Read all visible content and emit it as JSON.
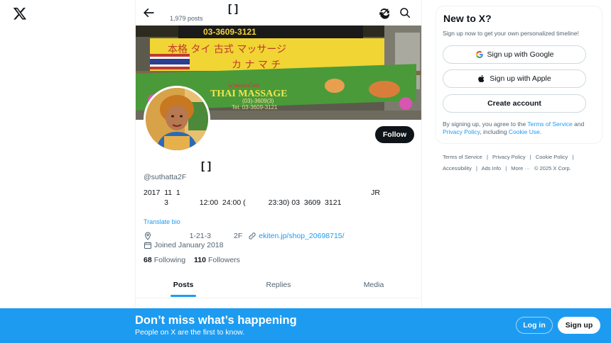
{
  "nav": {
    "logo_icon": "x-logo-icon"
  },
  "header": {
    "title": "[            ]",
    "posts_count": "1,979 posts",
    "back_icon": "arrow-left-icon",
    "icons": [
      "refresh-icon",
      "search-icon"
    ]
  },
  "banner": {
    "phone_top": "03-3609-3121",
    "sign_jp_1": "本格 タイ 古式 マッサージ",
    "sign_jp_2": "カ ナ マ チ",
    "banner_thai": "นวดแผนไทย",
    "banner_en": "THAI MASSAGE",
    "banner_phone": "Tel. 03-3609-3121",
    "banner_sub": "(03)-3609(3)"
  },
  "profile": {
    "name": "[            ]",
    "handle": "@suthatta2F",
    "follow_label": "Follow",
    "bio_line_1": "2017  11  1                                                                                            JR",
    "bio_line_2": "          3               12:00  24:00 (           23:30) 03  3609  3121",
    "translate_label": "Translate bio",
    "location": "                 1-21-3           2F",
    "website": "ekiten.jp/shop_20698715/",
    "joined": "Joined January 2018",
    "following_count": "68",
    "following_label": "Following",
    "followers_count": "110",
    "followers_label": "Followers"
  },
  "tabs": [
    {
      "label": "Posts",
      "active": true
    },
    {
      "label": "Replies",
      "active": false
    },
    {
      "label": "Media",
      "active": false
    }
  ],
  "signup_card": {
    "title": "New to X?",
    "subtitle": "Sign up now to get your own personalized timeline!",
    "google_label": "Sign up with Google",
    "apple_label": "Sign up with Apple",
    "create_label": "Create account",
    "terms_prefix": "By signing up, you agree to the ",
    "terms_link": "Terms of Service",
    "terms_and": " and ",
    "privacy_link": "Privacy Policy",
    "terms_including": ", including ",
    "cookie_link": "Cookie Use",
    "terms_end": "."
  },
  "footer": {
    "links": [
      "Terms of Service",
      "|",
      "Privacy Policy",
      "|",
      "Cookie Policy",
      "|",
      "Accessibility",
      "|",
      "Ads Info",
      "|",
      "More ···",
      "© 2025 X Corp."
    ]
  },
  "bottom_bar": {
    "title": "Don’t miss what’s happening",
    "subtitle": "People on X are the first to know.",
    "login_label": "Log in",
    "signup_label": "Sign up"
  },
  "colors": {
    "accent": "#1d9bf0",
    "text": "#0f1419",
    "muted": "#536471",
    "border": "#eff3f4"
  }
}
